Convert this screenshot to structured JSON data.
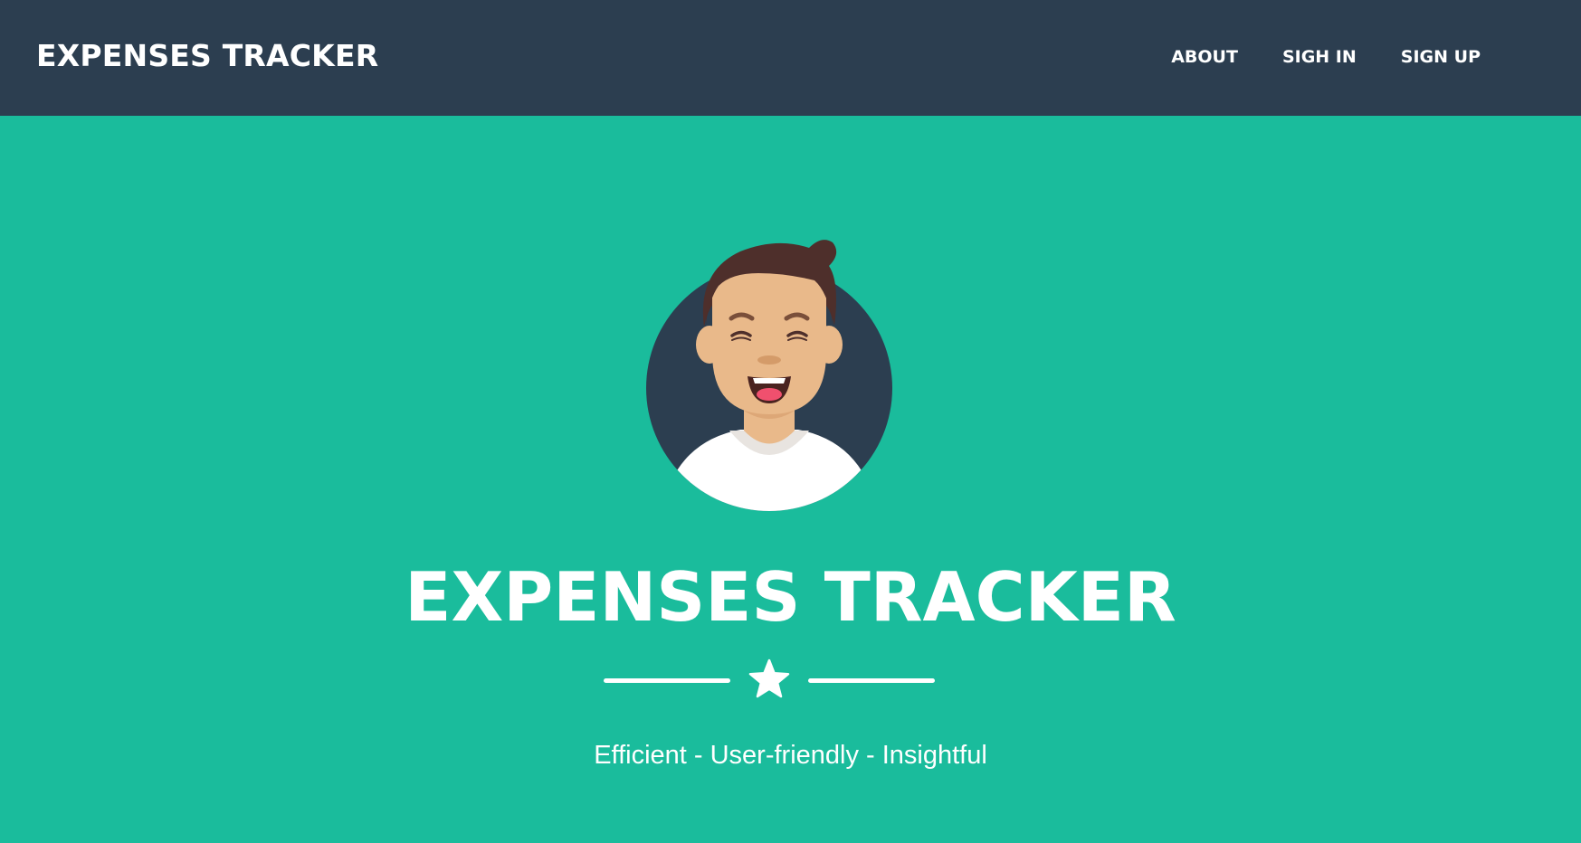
{
  "navbar": {
    "brand": "EXPENSES TRACKER",
    "links": [
      {
        "label": "ABOUT"
      },
      {
        "label": "SIGH IN"
      },
      {
        "label": "SIGN UP"
      }
    ]
  },
  "hero": {
    "avatar_icon": "smiling-man-avatar-icon",
    "title": "EXPENSES TRACKER",
    "divider_icon": "star-icon",
    "subtitle": "Efficient - User-friendly - Insightful"
  },
  "colors": {
    "navbar_bg": "#2c3e50",
    "page_bg": "#1abc9c",
    "text": "#ffffff",
    "hair": "#4e2f2b",
    "skin": "#e9b98a"
  }
}
